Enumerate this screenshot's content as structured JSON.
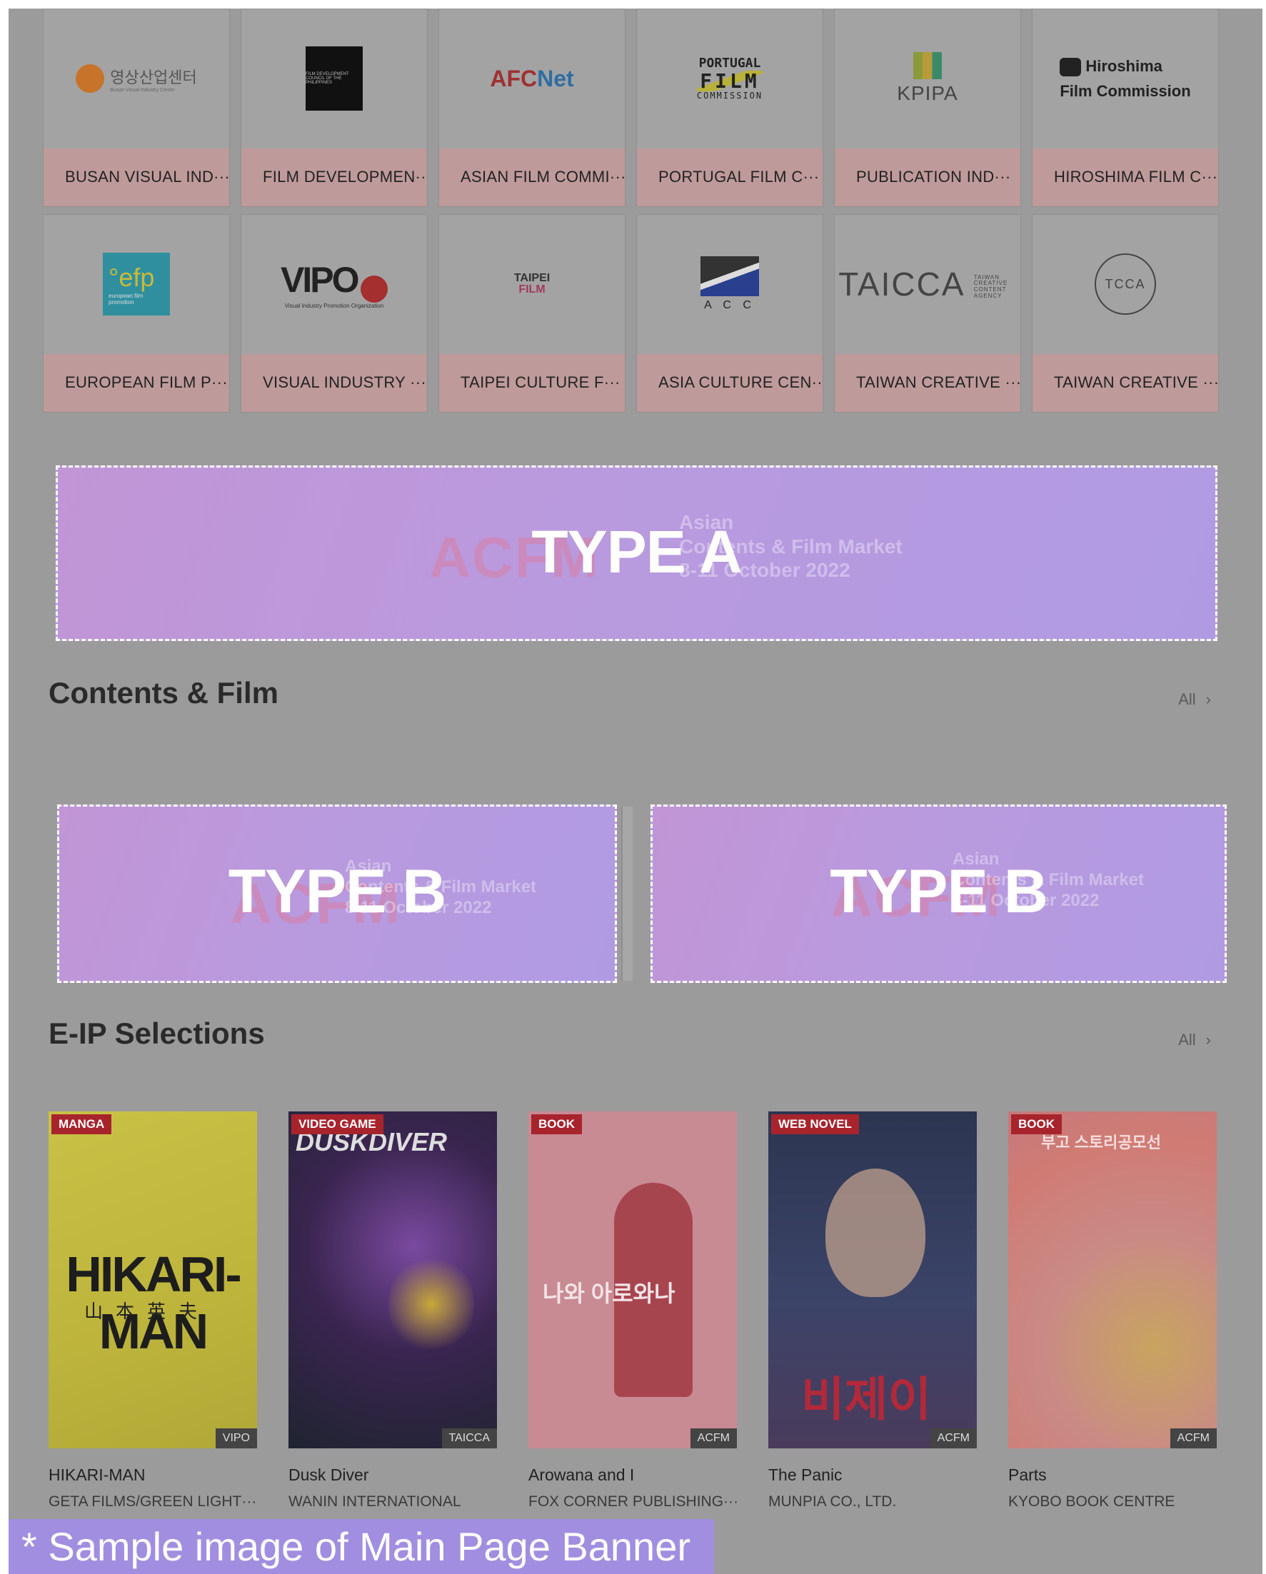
{
  "organizations": [
    {
      "name": "BUSAN VISUAL IND···",
      "logo": "busan-visual-industry-logo",
      "logo_text": "영상산업센터",
      "logo_sub": "Busan Visual Industry Center"
    },
    {
      "name": "FILM DEVELOPMEN···",
      "logo": "film-development-council-logo",
      "logo_text": "FILM DEVELOPMENT COUNCIL OF THE PHILIPPINES"
    },
    {
      "name": "ASIAN FILM COMMI···",
      "logo": "afcnet-logo",
      "logo_text": "AFC",
      "logo_text2": "Net"
    },
    {
      "name": "PORTUGAL FILM C···",
      "logo": "portugal-film-commission-logo",
      "logo_text": "PORTUGAL",
      "logo_text2": "FILM",
      "logo_text3": "COMMISSION"
    },
    {
      "name": "PUBLICATION IND···",
      "logo": "kpipa-logo",
      "logo_text": "KPIPA"
    },
    {
      "name": "HIROSHIMA FILM C···",
      "logo": "hiroshima-film-commission-logo",
      "logo_text": "Hiroshima",
      "logo_text2": "Film Commission"
    },
    {
      "name": "EUROPEAN FILM P···",
      "logo": "efp-logo",
      "logo_text": "°efp",
      "logo_sub": "european film promotion"
    },
    {
      "name": "VISUAL INDUSTRY ···",
      "logo": "vipo-logo",
      "logo_text": "VIPO",
      "logo_sub": "Visual Industry Promotion Organization"
    },
    {
      "name": "TAIPEI CULTURE F···",
      "logo": "taipei-film-commission-logo",
      "logo_text": "TAIPEI",
      "logo_text2": "FILM"
    },
    {
      "name": "ASIA CULTURE CEN···",
      "logo": "asia-culture-centre-logo",
      "logo_text": "A C C"
    },
    {
      "name": "TAIWAN CREATIVE ···",
      "logo": "taicca-logo",
      "logo_text": "TAICCA",
      "logo_sub": "TAIWAN CREATIVE CONTENT AGENCY"
    },
    {
      "name": "TAIWAN CREATIVE ···",
      "logo": "tcca-circle-logo",
      "logo_text": "TCCA"
    }
  ],
  "banner_a": {
    "label": "TYPE A",
    "ghost_logo": "ACFM",
    "ghost_lines": [
      "Asian",
      "Contents & Film Market",
      "8-11 October 2022"
    ]
  },
  "banner_b": [
    {
      "label": "TYPE B",
      "ghost_logo": "ACFM",
      "ghost_lines": [
        "Asian",
        "Contents & Film Market",
        "8-11 October 2022"
      ]
    },
    {
      "label": "TYPE B",
      "ghost_logo": "ACFM",
      "ghost_lines": [
        "Asian",
        "Contents & Film Market",
        "8-11 October 2022"
      ]
    }
  ],
  "sections": {
    "contents_film": {
      "title": "Contents & Film",
      "all_label": "All"
    },
    "eip": {
      "title": "E-IP Selections",
      "all_label": "All"
    }
  },
  "eip_items": [
    {
      "badge": "MANGA",
      "source": "VIPO",
      "title": "HIKARI-MAN",
      "company": "GETA FILMS/GREEN LIGHT···",
      "cover_text": "HIKARI-MAN",
      "cover_text2": "山本英夫"
    },
    {
      "badge": "VIDEO GAME",
      "source": "TAICCA",
      "title": "Dusk Diver",
      "company": "WANIN INTERNATIONAL",
      "cover_text": "DUSKDIVER"
    },
    {
      "badge": "BOOK",
      "source": "ACFM",
      "title": "Arowana and I",
      "company": "FOX CORNER PUBLISHING···",
      "cover_text": "나와 아로와나"
    },
    {
      "badge": "WEB NOVEL",
      "source": "ACFM",
      "title": "The Panic",
      "company": "MUNPIA CO., LTD.",
      "cover_text": "비제이"
    },
    {
      "badge": "BOOK",
      "source": "ACFM",
      "title": "Parts",
      "company": "KYOBO BOOK CENTRE",
      "cover_text": "부고 스토리공모선"
    }
  ],
  "caption": "* Sample image of Main Page Banner",
  "colors": {
    "overlay_gray": "#9b9b9b",
    "org_name_bg": "#bf9a9a",
    "banner_gradient_start": "#c195d6",
    "banner_gradient_end": "#b09be3",
    "badge_red": "#a8242d",
    "caption_bg": "#a18ee0"
  }
}
